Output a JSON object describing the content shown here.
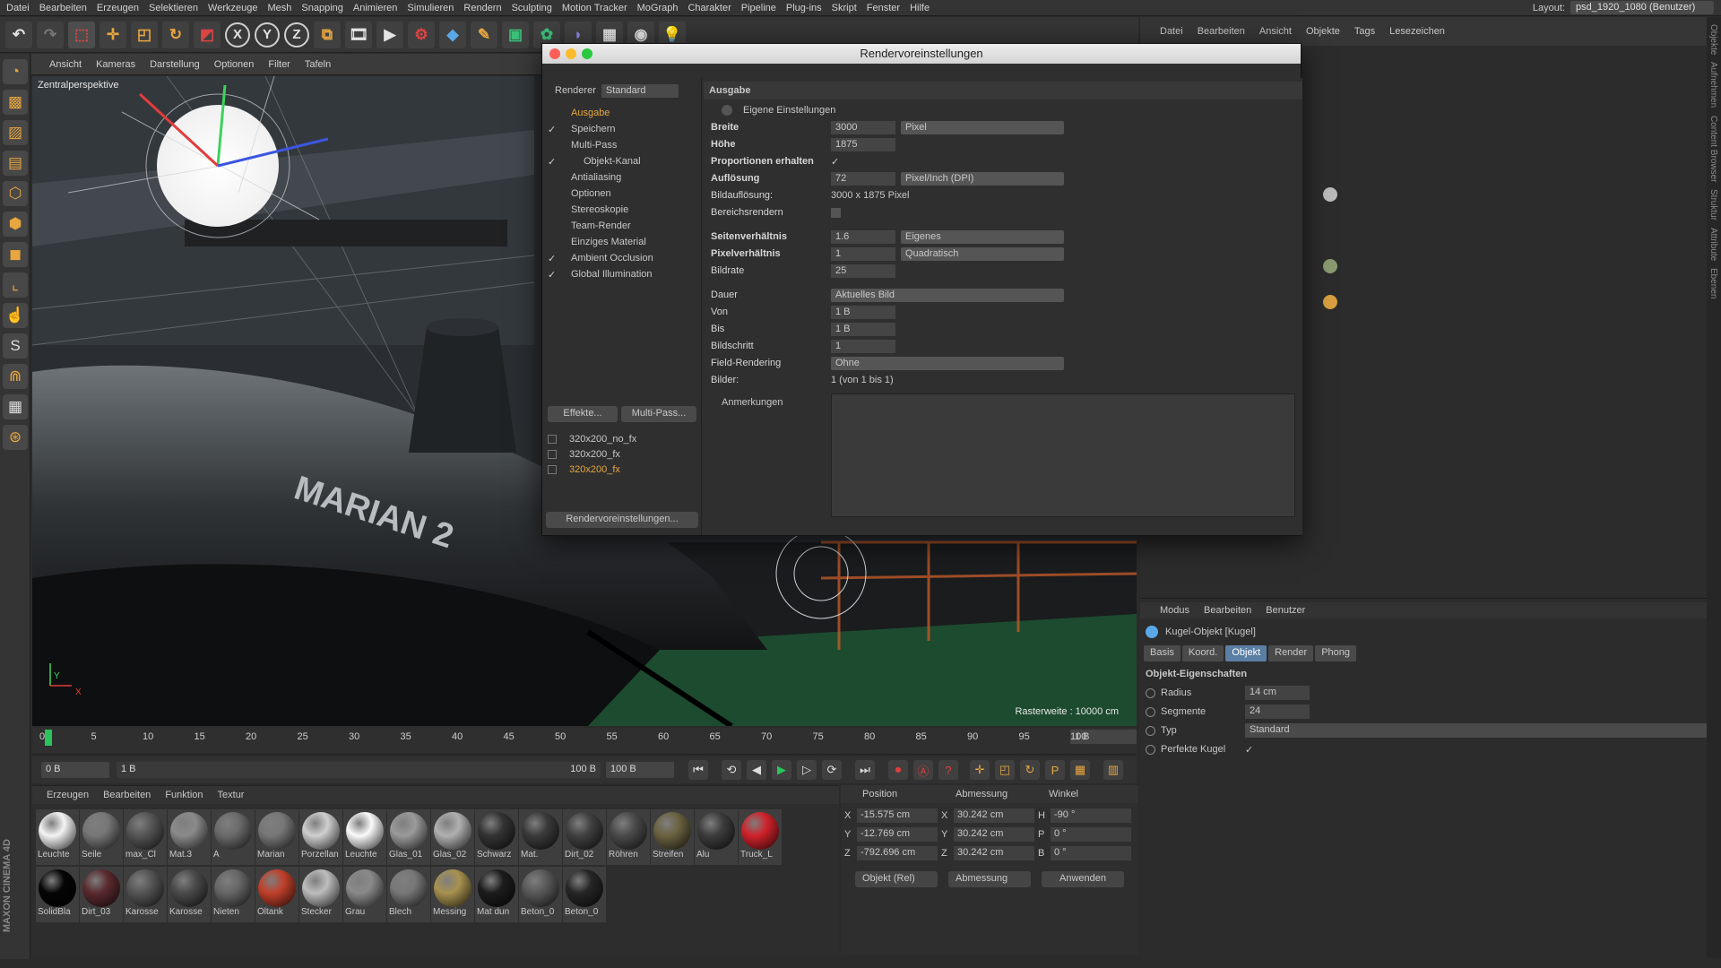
{
  "menubar": {
    "items": [
      "Datei",
      "Bearbeiten",
      "Erzeugen",
      "Selektieren",
      "Werkzeuge",
      "Mesh",
      "Snapping",
      "Animieren",
      "Simulieren",
      "Rendern",
      "Sculpting",
      "Motion Tracker",
      "MoGraph",
      "Charakter",
      "Pipeline",
      "Plug-ins",
      "Skript",
      "Fenster",
      "Hilfe"
    ],
    "layout_label": "Layout:",
    "layout_value": "psd_1920_1080 (Benutzer)"
  },
  "toolbar": {
    "x": "X",
    "y": "Y",
    "z": "Z"
  },
  "viewport": {
    "menu": [
      "Ansicht",
      "Kameras",
      "Darstellung",
      "Optionen",
      "Filter",
      "Tafeln"
    ],
    "title": "Zentralperspektive",
    "raster": "Rasterweite : 10000 cm",
    "hull_text": "MARIAN 2"
  },
  "timeline": {
    "ticks": [
      "0",
      "5",
      "10",
      "15",
      "20",
      "25",
      "30",
      "35",
      "40",
      "45",
      "50",
      "55",
      "60",
      "65",
      "70",
      "75",
      "80",
      "85",
      "90",
      "95",
      "100"
    ],
    "current": "1 B",
    "start": "0 B",
    "range_start": "1 B",
    "range_end": "100 B",
    "end": "100 B"
  },
  "materials": {
    "menu": [
      "Erzeugen",
      "Bearbeiten",
      "Funktion",
      "Textur"
    ],
    "items": [
      {
        "name": "Leuchte",
        "color": "#f4f4f4"
      },
      {
        "name": "Seile",
        "color": "#777"
      },
      {
        "name": "max_Cl",
        "color": "#555"
      },
      {
        "name": "Mat.3",
        "color": "#8a8a8a"
      },
      {
        "name": "A",
        "color": "#6a6a6a"
      },
      {
        "name": "Marian",
        "color": "#777"
      },
      {
        "name": "Porzellan",
        "color": "#cfcfcf"
      },
      {
        "name": "Leuchte",
        "color": "#fafafa"
      },
      {
        "name": "Glas_01",
        "color": "#9a9a9a"
      },
      {
        "name": "Glas_02",
        "color": "#b0b0b0"
      },
      {
        "name": "Schwarz",
        "color": "#333"
      },
      {
        "name": "Mat.",
        "color": "#3a3a3a"
      },
      {
        "name": "Dirt_02",
        "color": "#404040"
      },
      {
        "name": "Röhren",
        "color": "#4a4a4a"
      },
      {
        "name": "Streifen",
        "color": "#6b6240"
      },
      {
        "name": "Alu",
        "color": "#3c3c3c"
      },
      {
        "name": "Truck_L",
        "color": "#d0222a"
      },
      {
        "name": "SolidBla",
        "color": "#050505"
      },
      {
        "name": "Dirt_03",
        "color": "#5a2a2e"
      },
      {
        "name": "Karosse",
        "color": "#555"
      },
      {
        "name": "Karosse",
        "color": "#4a4a4a"
      },
      {
        "name": "Nieten",
        "color": "#666"
      },
      {
        "name": "Öltank",
        "color": "#c0402a"
      },
      {
        "name": "Stecker",
        "color": "#bdbdbd"
      },
      {
        "name": "Grau",
        "color": "#8a8a8a"
      },
      {
        "name": "Blech",
        "color": "#777"
      },
      {
        "name": "Messing",
        "color": "#a89250"
      },
      {
        "name": "Mat dun",
        "color": "#1c1c1c"
      },
      {
        "name": "Beton_0",
        "color": "#585858"
      },
      {
        "name": "Beton_0",
        "color": "#262626"
      }
    ]
  },
  "coords": {
    "headers": [
      "Position",
      "Abmessung",
      "Winkel"
    ],
    "rows": [
      {
        "axis": "X",
        "pos": "-15.575 cm",
        "dim": "30.242 cm",
        "ang_axis": "H",
        "ang": "-90 °"
      },
      {
        "axis": "Y",
        "pos": "-12.769 cm",
        "dim": "30.242 cm",
        "ang_axis": "P",
        "ang": "0 °"
      },
      {
        "axis": "Z",
        "pos": "-792.696 cm",
        "dim": "30.242 cm",
        "ang_axis": "B",
        "ang": "0 °"
      }
    ],
    "mode_select": "Objekt (Rel)",
    "size_select": "Abmessung",
    "apply": "Anwenden"
  },
  "objects_panel": {
    "menu": [
      "Datei",
      "Bearbeiten",
      "Ansicht",
      "Objekte",
      "Tags",
      "Lesezeichen"
    ]
  },
  "attributes": {
    "menu": [
      "Modus",
      "Bearbeiten",
      "Benutzer"
    ],
    "object": "Kugel-Objekt [Kugel]",
    "tabs": [
      "Basis",
      "Koord.",
      "Objekt",
      "Render",
      "Phong"
    ],
    "section": "Objekt-Eigenschaften",
    "radius_label": "Radius",
    "radius": "14 cm",
    "segments_label": "Segmente",
    "segments": "24",
    "type_label": "Typ",
    "type": "Standard",
    "perfect_label": "Perfekte Kugel",
    "perfect_check": "✓"
  },
  "sidetabs": [
    "Objekte",
    "Aufnehmen",
    "Content Browser",
    "Struktur",
    "Attribute",
    "Ebenen"
  ],
  "render_dialog": {
    "title": "Rendervoreinstellungen",
    "renderer_label": "Renderer",
    "renderer": "Standard",
    "left_items": [
      {
        "check": "",
        "label": "Ausgabe",
        "active": true
      },
      {
        "check": "✓",
        "label": "Speichern"
      },
      {
        "check": "",
        "label": "Multi-Pass"
      },
      {
        "check": "✓",
        "label": "Objekt-Kanal"
      },
      {
        "check": "",
        "label": "Antialiasing"
      },
      {
        "check": "",
        "label": "Optionen"
      },
      {
        "check": "",
        "label": "Stereoskopie"
      },
      {
        "check": "",
        "label": "Team-Render"
      },
      {
        "check": "",
        "label": "Einziges Material"
      },
      {
        "check": "✓",
        "label": "Ambient Occlusion"
      },
      {
        "check": "✓",
        "label": "Global Illumination"
      }
    ],
    "effects_btn": "Effekte...",
    "multipass_btn": "Multi-Pass...",
    "presets": [
      "320x200_no_fx",
      "320x200_fx",
      "320x200_fx"
    ],
    "bottom_btn": "Rendervoreinstellungen...",
    "section": "Ausgabe",
    "custom": "Eigene Einstellungen",
    "width_label": "Breite",
    "width": "3000",
    "unit": "Pixel",
    "height_label": "Höhe",
    "height": "1875",
    "keep_label": "Proportionen erhalten",
    "keep_check": "✓",
    "res_label": "Auflösung",
    "res": "72",
    "res_unit": "Pixel/Inch (DPI)",
    "img_res_label": "Bildauflösung:",
    "img_res": "3000 x 1875 Pixel",
    "region_label": "Bereichsrendern",
    "aspect_label": "Seitenverhältnis",
    "aspect": "1.6",
    "aspect_sel": "Eigenes",
    "pixel_label": "Pixelverhältnis",
    "pixel": "1",
    "pixel_sel": "Quadratisch",
    "fps_label": "Bildrate",
    "fps": "25",
    "duration_label": "Dauer",
    "duration": "Aktuelles Bild",
    "from_label": "Von",
    "from": "1 B",
    "to_label": "Bis",
    "to": "1 B",
    "step_label": "Bildschritt",
    "step": "1",
    "field_label": "Field-Rendering",
    "field": "Ohne",
    "frames_label": "Bilder:",
    "frames": "1 (von 1 bis 1)",
    "notes_label": "Anmerkungen"
  },
  "colors": {
    "accent": "#e8a640",
    "active_tab": "#5b7fa4",
    "play": "#29c45a"
  }
}
